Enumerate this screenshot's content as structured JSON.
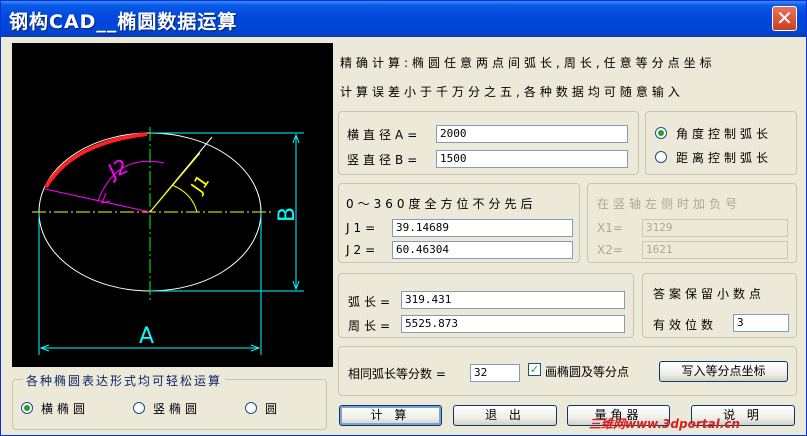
{
  "window": {
    "title": "钢构CAD__椭圆数据运算",
    "close_glyph": "✕"
  },
  "info": {
    "line1": "精确计算:椭圆任意两点间弧长,周长,任意等分点坐标",
    "line2": "计算误差小于千万分之五,各种数据均可随意输入"
  },
  "diameters": {
    "horizontal_label": "横直径A=",
    "horizontal_value": "2000",
    "vertical_label": "竖直径B=",
    "vertical_value": "1500"
  },
  "control": {
    "angle_label": "角度控制弧长",
    "distance_label": "距离控制弧长",
    "selected": "angle"
  },
  "angles": {
    "title": "0～360度全方位不分先后",
    "j1_label": "J1=",
    "j1_value": "39.14689",
    "j2_label": "J2=",
    "j2_value": "60.46304"
  },
  "xfields": {
    "title": "在竖轴左侧时加负号",
    "x1_label": "X1=",
    "x1_value": "3129",
    "x2_label": "X2=",
    "x2_value": "1621"
  },
  "results": {
    "arc_label": "弧长=",
    "arc_value": "319.431",
    "perimeter_label": "周长=",
    "perimeter_value": "5525.873"
  },
  "decimals": {
    "title": "答案保留小数点",
    "label": "有效位数",
    "value": "3"
  },
  "divide": {
    "label": "相同弧长等分数 =",
    "value": "32",
    "checkbox_label": "画椭圆及等分点",
    "checked": true,
    "write_button": "写入等分点坐标"
  },
  "forms": {
    "title": "各种椭圆表达形式均可轻松运算",
    "horizontal": "横椭圆",
    "vertical": "竖椭圆",
    "circle": "圆",
    "selected": "horizontal"
  },
  "buttons": {
    "calc": "计 算",
    "exit": "退 出",
    "angle": "量角器",
    "help": "说 明"
  },
  "diagram": {
    "label_a": "A",
    "label_b": "B",
    "label_j1": "J1",
    "label_j2": "J2"
  },
  "watermark": "三维网www.3dportal.cn",
  "colors": {
    "titlebar": "#0046D5",
    "arc": "#FF2020",
    "dimension": "#00FFFF",
    "angle": "#FF00FF",
    "axis": "#FFFF00"
  }
}
